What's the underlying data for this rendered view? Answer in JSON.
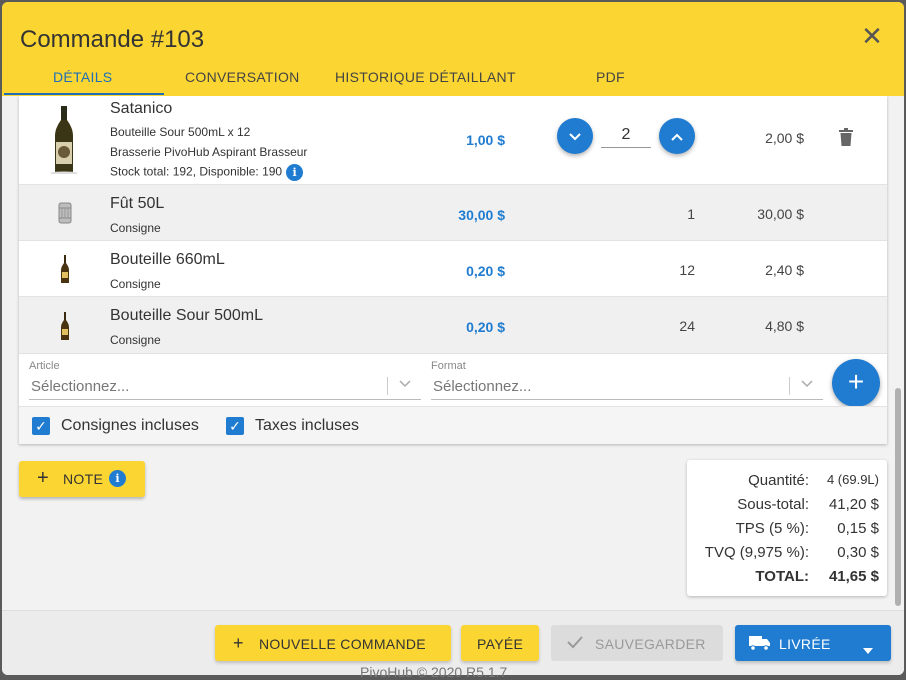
{
  "dialog": {
    "title": "Commande #103",
    "tabs": [
      "DÉTAILS",
      "CONVERSATION",
      "HISTORIQUE DÉTAILLANT",
      "PDF"
    ]
  },
  "items": [
    {
      "name": "Satanico",
      "lines": [
        "Bouteille Sour 500mL x 12",
        "Brasserie PivoHub Aspirant Brasseur"
      ],
      "stock": "Stock total: 192,  Disponible: 190",
      "price": "1,00 $",
      "qty": "2",
      "total": "2,00 $"
    },
    {
      "name": "Fût 50L",
      "sub": "Consigne",
      "price": "30,00 $",
      "qty": "1",
      "total": "30,00 $"
    },
    {
      "name": "Bouteille 660mL",
      "sub": "Consigne",
      "price": "0,20 $",
      "qty": "12",
      "total": "2,40 $"
    },
    {
      "name": "Bouteille Sour 500mL",
      "sub": "Consigne",
      "price": "0,20 $",
      "qty": "24",
      "total": "4,80 $"
    }
  ],
  "add_form": {
    "article_label": "Article",
    "article_placeholder": "Sélectionnez...",
    "format_label": "Format",
    "format_placeholder": "Sélectionnez..."
  },
  "options": {
    "deposits": "Consignes incluses",
    "taxes": "Taxes incluses"
  },
  "note_button": "NOTE",
  "summary": {
    "quantity_label": "Quantité:",
    "quantity": "4 (69.9L)",
    "subtotal_label": "Sous-total:",
    "subtotal": "41,20 $",
    "tps_label": "TPS (5 %):",
    "tps": "0,15 $",
    "tvq_label": "TVQ (9,975 %):",
    "tvq": "0,30 $",
    "total_label": "TOTAL:",
    "total": "41,65 $"
  },
  "footer": {
    "new_order": "NOUVELLE COMMANDE",
    "paid": "PAYÉE",
    "save": "SAUVEGARDER",
    "delivered": "LIVRÉE"
  },
  "background_peek": "PivoHub © 2020 R5.1.7",
  "colors": {
    "accent": "#1f7cd0",
    "header": "#fbd531"
  }
}
